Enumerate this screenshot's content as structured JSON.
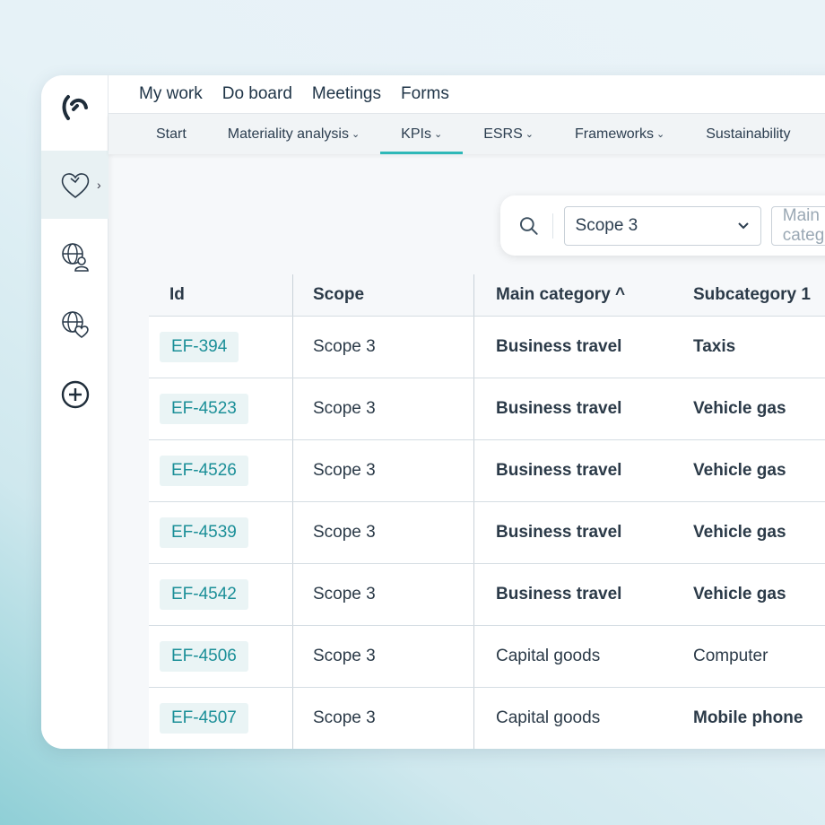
{
  "top_nav": [
    "My work",
    "Do board",
    "Meetings",
    "Forms"
  ],
  "sub_nav": [
    {
      "label": "Start",
      "dropdown": false
    },
    {
      "label": "Materiality analysis",
      "dropdown": true
    },
    {
      "label": "KPIs",
      "dropdown": true,
      "active": true
    },
    {
      "label": "ESRS",
      "dropdown": true
    },
    {
      "label": "Frameworks",
      "dropdown": true
    },
    {
      "label": "Sustainability",
      "dropdown": false
    }
  ],
  "filters": {
    "scope_value": "Scope 3",
    "main_category_placeholder": "Main category"
  },
  "table": {
    "headers": [
      "Id",
      "Scope",
      "Main category ^",
      "Subcategory 1"
    ],
    "rows": [
      [
        "EF-394",
        "Scope 3",
        "Business travel",
        "Taxis"
      ],
      [
        "EF-4523",
        "Scope 3",
        "Business travel",
        "Vehicle gas"
      ],
      [
        "EF-4526",
        "Scope 3",
        "Business travel",
        "Vehicle gas"
      ],
      [
        "EF-4539",
        "Scope 3",
        "Business travel",
        "Vehicle gas"
      ],
      [
        "EF-4542",
        "Scope 3",
        "Business travel",
        "Vehicle gas"
      ],
      [
        "EF-4506",
        "Scope 3",
        "Capital goods",
        "Computer"
      ],
      [
        "EF-4507",
        "Scope 3",
        "Capital goods",
        "Mobile phone"
      ]
    ]
  },
  "colors": {
    "accent": "#2fb8b8",
    "id_text": "#1b8f98"
  }
}
